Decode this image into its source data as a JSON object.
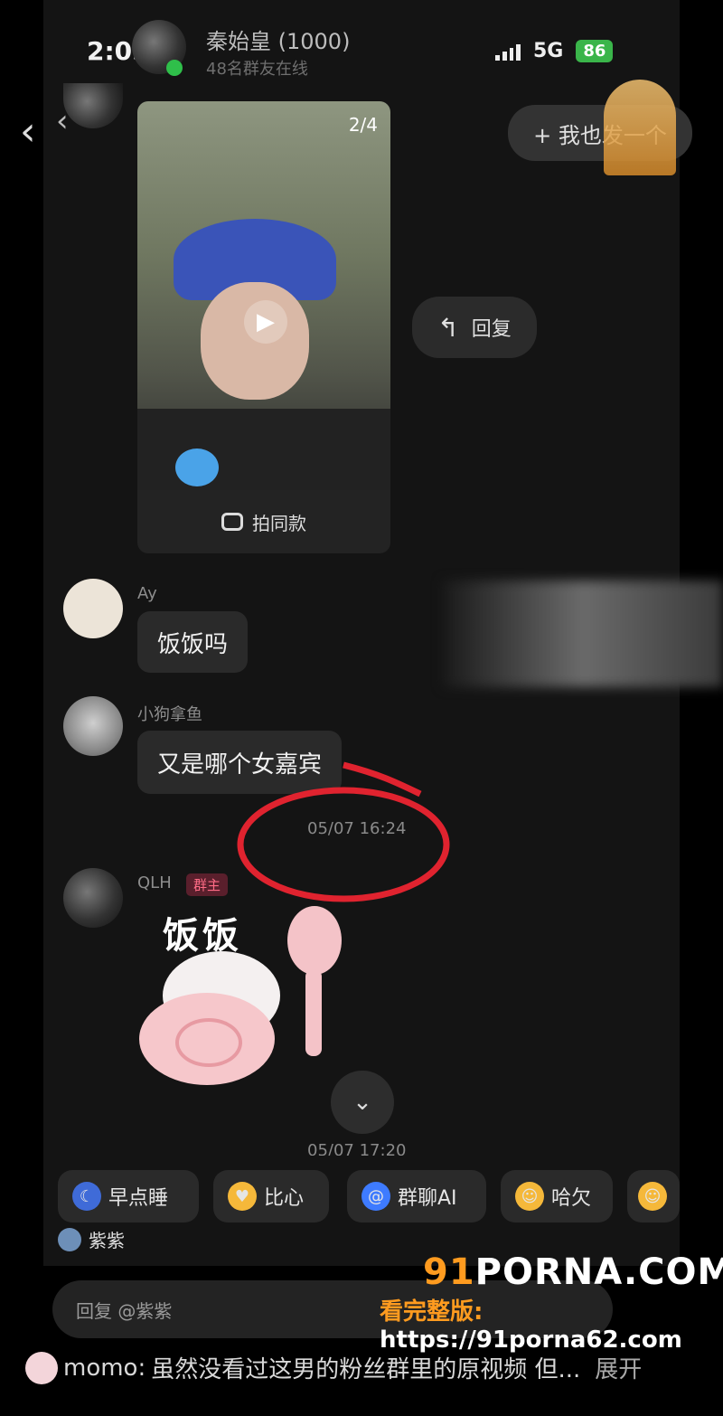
{
  "status_bar": {
    "time": "2:05",
    "network": "5G",
    "battery": "86"
  },
  "header": {
    "group_name": "秦始皇 (1000)",
    "online": "48名群友在线"
  },
  "video": {
    "counter": "2/4",
    "action_label": "拍同款"
  },
  "reply_pill": {
    "label": "回复"
  },
  "top_pill": {
    "label": "+ 我也发一个"
  },
  "messages": [
    {
      "sender": "Ay",
      "text": "饭饭吗"
    },
    {
      "sender": "小狗拿鱼",
      "text": "又是哪个女嘉宾"
    }
  ],
  "timestamp_1": "05/07 16:24",
  "qlh": {
    "sender": "QLH",
    "badge": "群主",
    "sticker_text": "饭饭"
  },
  "timestamp_2": "05/07 17:20",
  "quick_chips": [
    {
      "label": "早点睡",
      "icon": "moon-icon",
      "color": "#3f6bd8"
    },
    {
      "label": "比心",
      "icon": "heart-hands-icon",
      "color": "#f5b83a"
    },
    {
      "label": "群聊AI",
      "icon": "ai-icon",
      "color": "#3e7bff"
    },
    {
      "label": "哈欠",
      "icon": "yawn-icon",
      "color": "#f5b83a"
    }
  ],
  "reply_target": {
    "name": "紫紫"
  },
  "input": {
    "placeholder": "回复 @紫紫"
  },
  "caption": {
    "user": "momo:",
    "text": "虽然没看过这男的粉丝群里的原视频 但...",
    "more": "展开"
  },
  "watermark": {
    "logo_prefix": "91",
    "logo_rest": "PORNA.COM",
    "url_label": "看完整版:",
    "url": "https://91porna62.com"
  }
}
